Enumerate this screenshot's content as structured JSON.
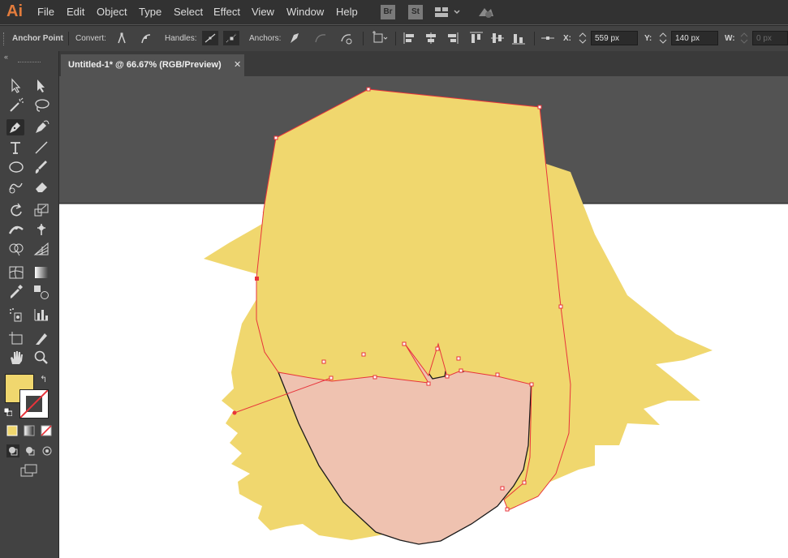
{
  "app": {
    "logo": "Ai"
  },
  "menu": {
    "items": [
      "File",
      "Edit",
      "Object",
      "Type",
      "Select",
      "Effect",
      "View",
      "Window",
      "Help"
    ]
  },
  "bridge": {
    "br": "Br",
    "st": "St"
  },
  "control": {
    "anchor_point_label": "Anchor Point",
    "convert_label": "Convert:",
    "handles_label": "Handles:",
    "anchors_label": "Anchors:",
    "x_label": "X:",
    "x_value": "559 px",
    "y_label": "Y:",
    "y_value": "140 px",
    "w_label": "W:",
    "w_value": "0 px"
  },
  "tab": {
    "title": "Untitled-1* @ 66.67% (RGB/Preview)",
    "close": "✕"
  },
  "colors": {
    "fill": "#f0d76e",
    "hair": "#f0d76e",
    "skin": "#efc2b0",
    "path_red": "#e8333a",
    "artboard": "#ffffff"
  }
}
